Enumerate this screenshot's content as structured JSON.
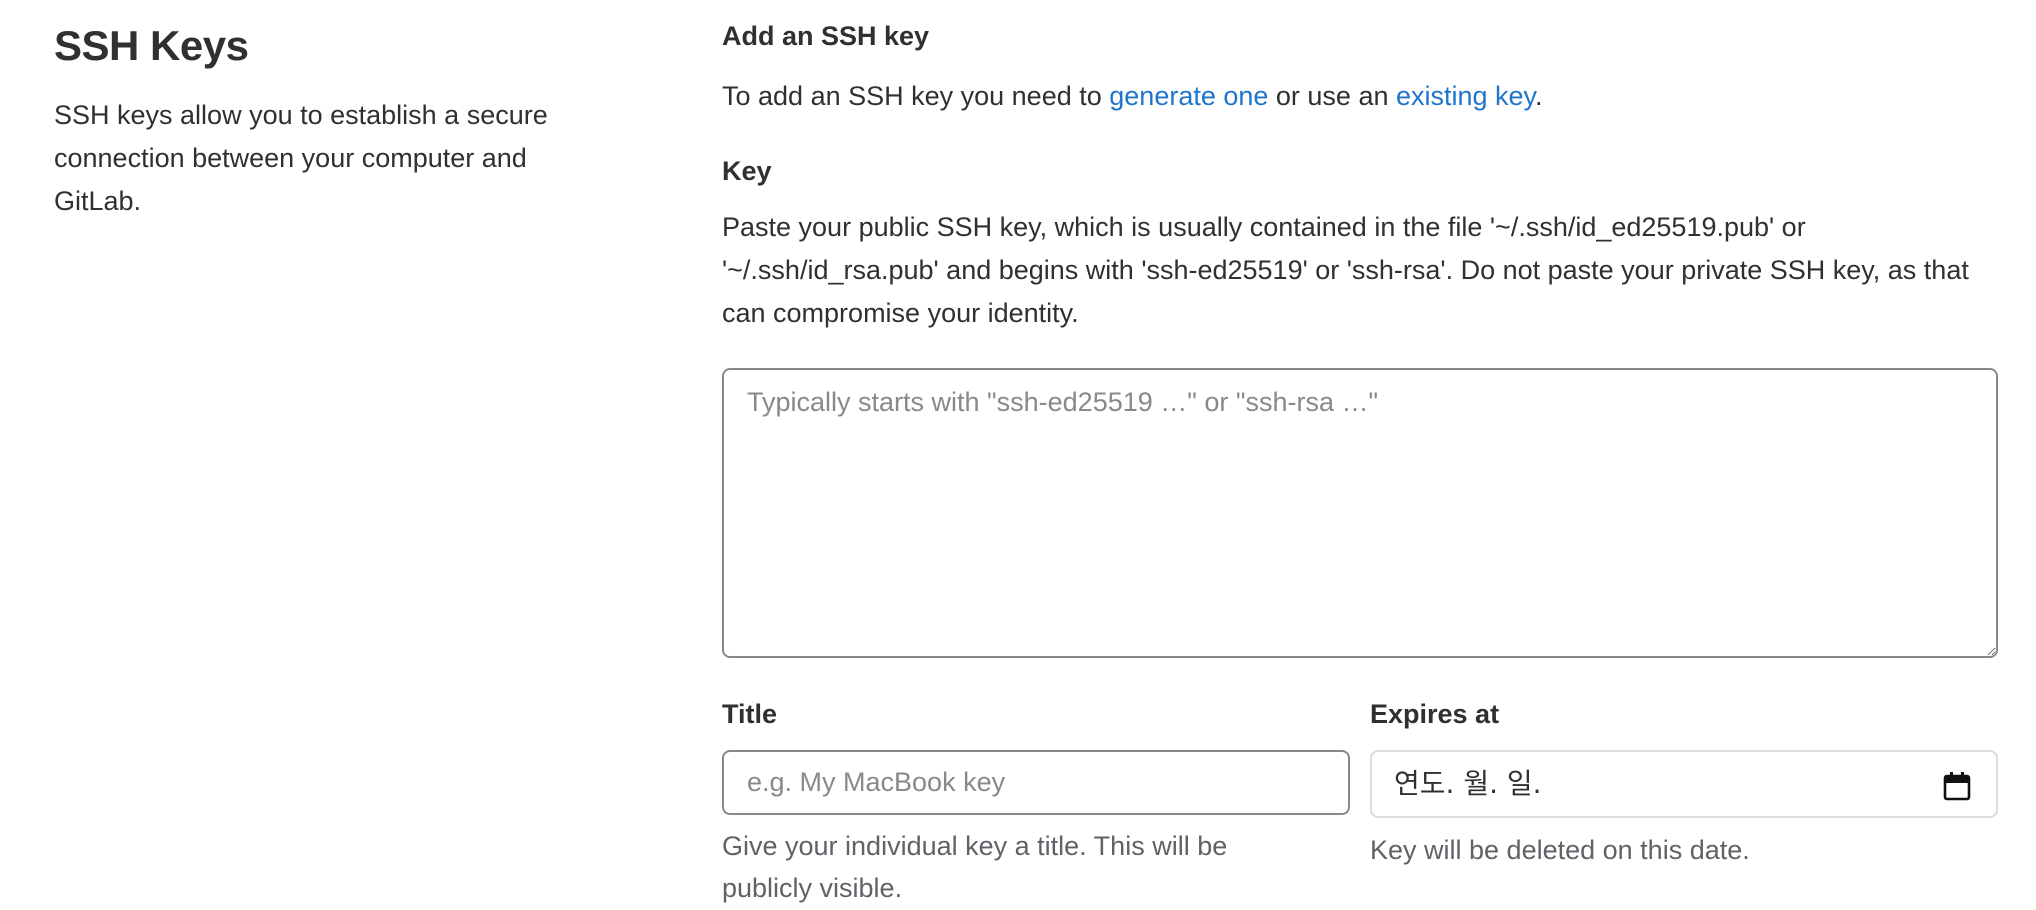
{
  "sidebar": {
    "title": "SSH Keys",
    "description": "SSH keys allow you to establish a secure connection between your computer and GitLab."
  },
  "form": {
    "heading": "Add an SSH key",
    "intro": {
      "prefix": "To add an SSH key you need to ",
      "link_generate": "generate one",
      "middle": " or use an ",
      "link_existing": "existing key",
      "suffix": "."
    },
    "key": {
      "label": "Key",
      "help": "Paste your public SSH key, which is usually contained in the file '~/.ssh/id_ed25519.pub' or '~/.ssh/id_rsa.pub' and begins with 'ssh-ed25519' or 'ssh-rsa'. Do not paste your private SSH key, as that can compromise your identity.",
      "placeholder": "Typically starts with \"ssh-ed25519 …\" or \"ssh-rsa …\"",
      "value": ""
    },
    "title": {
      "label": "Title",
      "placeholder": "e.g. My MacBook key",
      "value": "",
      "help": "Give your individual key a title. This will be publicly visible."
    },
    "expires": {
      "label": "Expires at",
      "placeholder": "연도. 월. 일.",
      "help": "Key will be deleted on this date.",
      "icon": "calendar-icon"
    }
  },
  "colors": {
    "text": "#303030",
    "link": "#1f75cb",
    "muted": "#626168",
    "input_border": "#89888d",
    "date_border": "#dcdcde"
  }
}
